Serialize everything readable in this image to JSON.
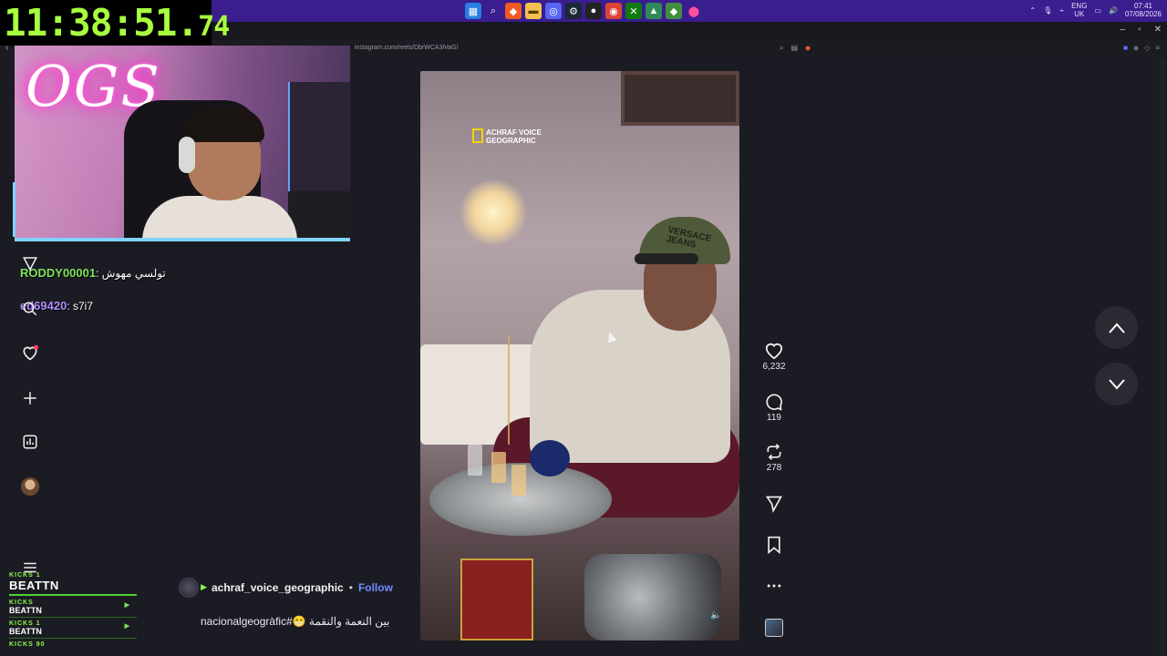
{
  "stream": {
    "timer_main": "11:38:51.",
    "timer_ms": "74",
    "neon_sign": "OGS"
  },
  "taskbar": {
    "icons": [
      "windows-start-icon",
      "search-icon",
      "brave-browser-icon",
      "file-explorer-icon",
      "discord-icon",
      "steam-icon",
      "obs-icon",
      "chrome-icon",
      "xbox-icon",
      "app-icon",
      "app-icon",
      "maps-pin-icon"
    ],
    "lang_top": "ENG",
    "lang_bottom": "UK",
    "time": "07:41",
    "date": "07/08/2026"
  },
  "browser": {
    "url": "instagram.com/reels/DbrWCA3iVaG/",
    "window_controls": [
      "–",
      "▫",
      "✕"
    ]
  },
  "chat": [
    {
      "user": "RODDY00001",
      "message": "تولسي مهوش"
    },
    {
      "user": "ed69420",
      "message": "s7i7"
    }
  ],
  "kicks": {
    "label": "KICKS 1",
    "name": "BEATTN",
    "rows": [
      {
        "label": "KICKS",
        "name": "BEATTN"
      },
      {
        "label": "KICKS 1",
        "name": "BEATTN"
      },
      {
        "label": "KICKS 90",
        "name": ""
      }
    ]
  },
  "reel": {
    "watermark_line1": "ACHRAF VOICE",
    "watermark_line2": "GEOGRAPHIC",
    "cap_text_line1": "VERSACE",
    "cap_text_line2": "JEANS",
    "author": "achraf_voice_geographic",
    "separator": "•",
    "follow_label": "Follow",
    "caption": "nacionalgeogràfic#😁 بين النعمة والنقمة"
  },
  "actions": {
    "likes": "6,232",
    "comments": "119",
    "reposts": "278"
  },
  "colors": {
    "taskbar": "#3a1d8e",
    "timer_text": "#a8ff3e",
    "follow": "#6f8cff",
    "background": "#1b1b23"
  }
}
